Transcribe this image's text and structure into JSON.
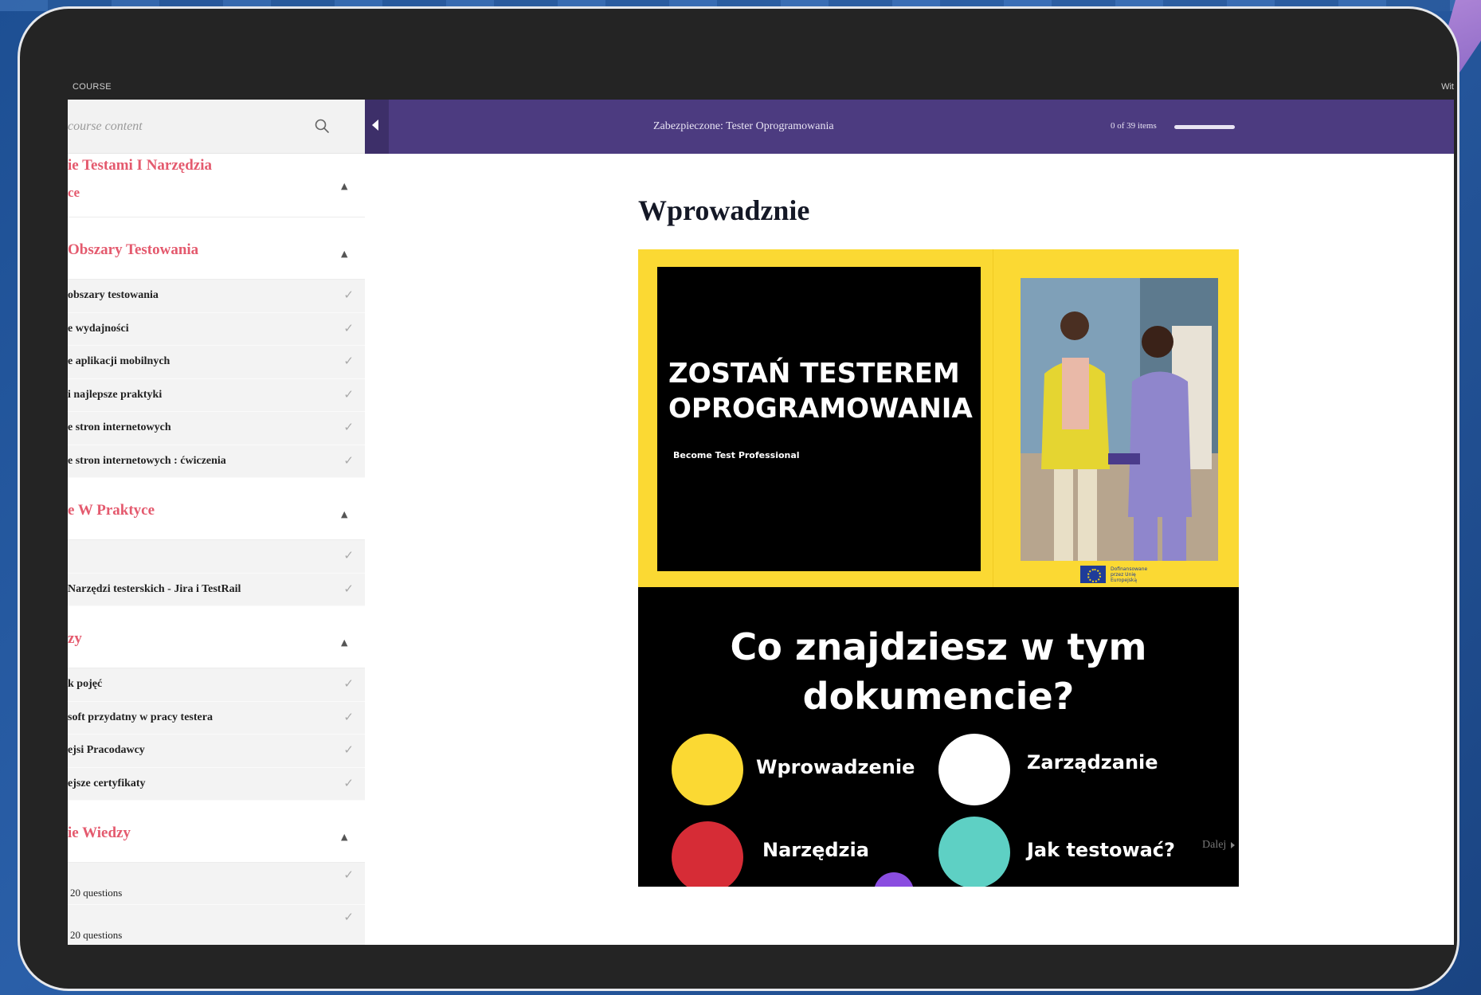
{
  "app": {
    "top_label": "COURSE",
    "top_right": "Wit"
  },
  "sidebar": {
    "search_placeholder": "course content",
    "sections": [
      {
        "title_lines": [
          "ie Testami I Narzędzia",
          "ce"
        ],
        "items": []
      },
      {
        "title_lines": [
          "Obszary Testowania"
        ],
        "items": [
          {
            "label": "obszary testowania"
          },
          {
            "label": "e wydajności"
          },
          {
            "label": "e aplikacji mobilnych"
          },
          {
            "label": "i najlepsze praktyki"
          },
          {
            "label": "e stron internetowych"
          },
          {
            "label": "e stron internetowych : ćwiczenia"
          }
        ]
      },
      {
        "title_lines": [
          "e W Praktyce"
        ],
        "items": [
          {
            "label": ""
          },
          {
            "label": "Narzędzi testerskich - Jira i TestRail"
          }
        ]
      },
      {
        "title_lines": [
          "zy"
        ],
        "items": [
          {
            "label": "k pojęć"
          },
          {
            "label": "soft przydatny w pracy testera"
          },
          {
            "label": "ejsi Pracodawcy"
          },
          {
            "label": "ejsze certyfikaty"
          }
        ]
      },
      {
        "title_lines": [
          "ie Wiedzy"
        ],
        "items": [
          {
            "label": "20 questions",
            "quiz": true
          },
          {
            "label": "20 questions",
            "quiz": true
          }
        ]
      }
    ]
  },
  "header": {
    "course_title": "Zabezpieczone: Tester Oprogramowania",
    "progress_text": "0 of 39 items",
    "progress_fraction": 0
  },
  "lesson": {
    "title": "Wprowadznie",
    "next_label": "Dalej"
  },
  "slide": {
    "headline_line1": "ZOSTAŃ TESTEREM",
    "headline_line2": "OPROGRAMOWANIA",
    "tagline": "Become Test Professional",
    "eu_note": "Dofinansowane przez Unię Europejską",
    "question_line1": "Co znajdziesz w tym",
    "question_line2": "dokumencie?",
    "topics": [
      {
        "label": "Wprowadzenie",
        "color": "#fbd933"
      },
      {
        "label": "Zarządzanie",
        "color": "#ffffff"
      },
      {
        "label": "Narzędzia",
        "color": "#d62c36"
      },
      {
        "label": "Jak testować?",
        "color": "#5ed0c4"
      }
    ],
    "extra_dot_color": "#8a4de0"
  },
  "colors": {
    "accent_title": "#e45a6e",
    "header_bg": "#4c3b80",
    "slide_yellow": "#fbd933"
  },
  "icons": {
    "search": "search-icon",
    "collapse": "chevron-up-icon",
    "done": "check-icon",
    "toggle": "caret-left-icon",
    "next": "caret-right-icon"
  }
}
